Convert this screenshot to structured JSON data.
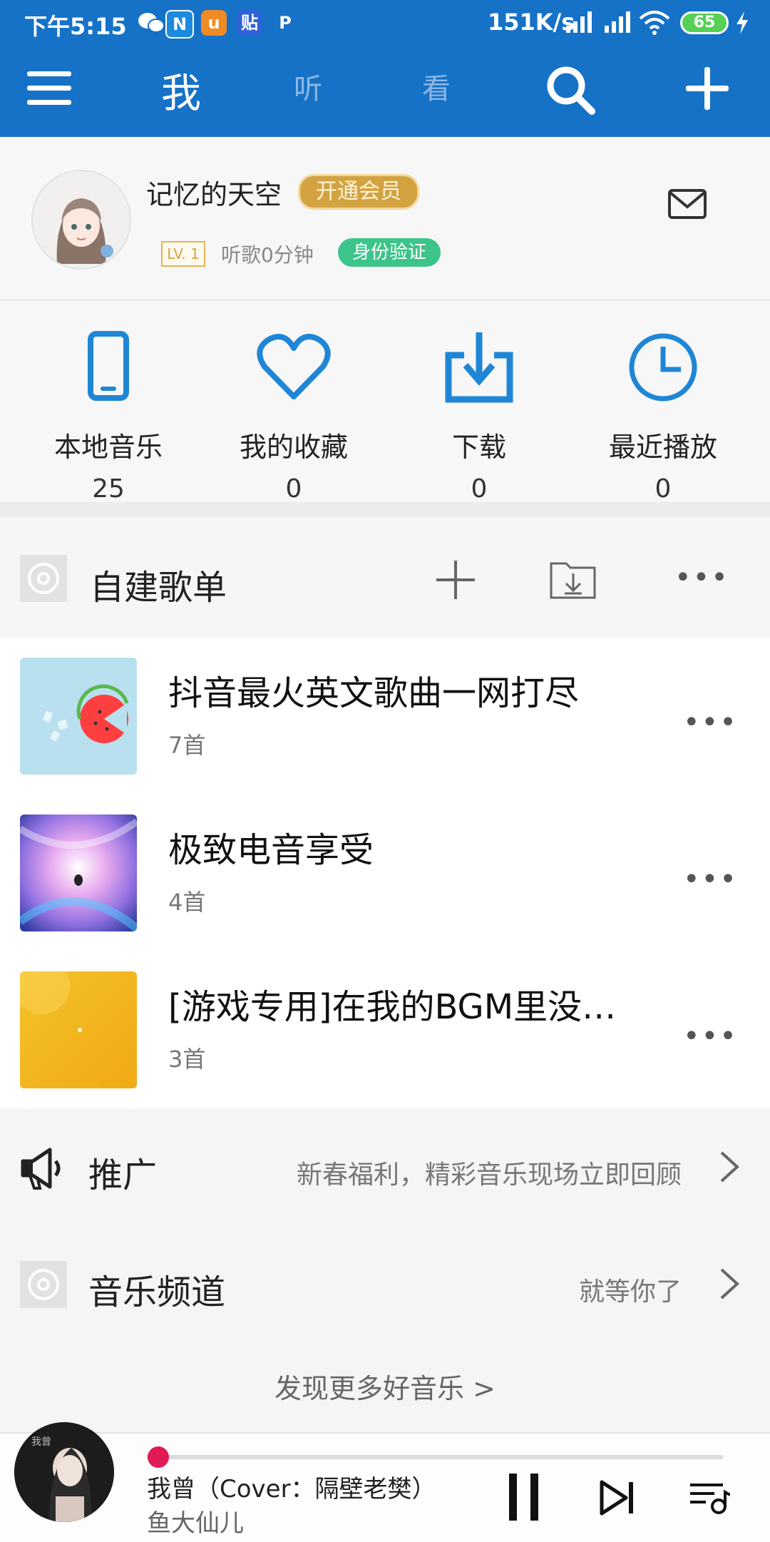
{
  "status": {
    "time": "下午5:15",
    "network": "151K/s",
    "battery": "65",
    "notifications": [
      "wechat-icon",
      "n-app-icon",
      "uc-icon",
      "tieba-icon",
      "p-icon"
    ]
  },
  "header": {
    "tabs": [
      "我",
      "听",
      "看"
    ],
    "active_tab": "我"
  },
  "profile": {
    "username": "记忆的天空",
    "vip_label": "开通会员",
    "level": "LV. 1",
    "listen_time": "听歌0分钟",
    "verify_label": "身份验证"
  },
  "entries": [
    {
      "label": "本地音乐",
      "count": "25",
      "icon": "phone-icon"
    },
    {
      "label": "我的收藏",
      "count": "0",
      "icon": "heart-icon"
    },
    {
      "label": "下载",
      "count": "0",
      "icon": "download-icon"
    },
    {
      "label": "最近播放",
      "count": "0",
      "icon": "clock-icon"
    }
  ],
  "playlists": {
    "title": "自建歌单",
    "items": [
      {
        "name": "抖音最火英文歌曲一网打尽",
        "count": "7首"
      },
      {
        "name": "极致电音享受",
        "count": "4首"
      },
      {
        "name": "[游戏专用]在我的BGM里没…",
        "count": "3首"
      }
    ]
  },
  "promo": {
    "title": "推广",
    "subtitle": "新春福利，精彩音乐现场立即回顾"
  },
  "channel": {
    "title": "音乐频道",
    "subtitle": "就等你了"
  },
  "discover": "发现更多好音乐 >",
  "player": {
    "song": "我曾（Cover：隔壁老樊）",
    "artist": "鱼大仙儿",
    "progress": 0.02
  },
  "colors": {
    "header_bg": "#1672c7",
    "icon_blue": "#1f86d6",
    "vip_gold": "#d3a341",
    "verify_green": "#3cc48a",
    "progress_red": "#e21a56"
  }
}
